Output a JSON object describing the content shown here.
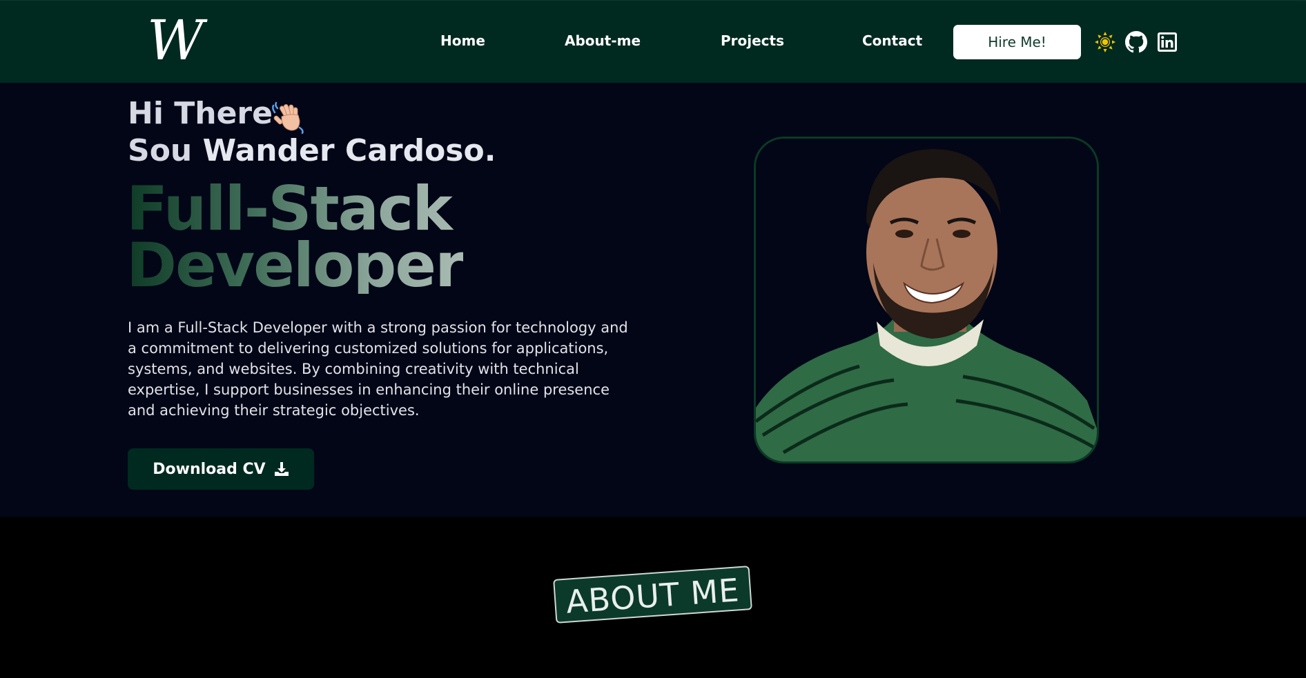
{
  "brand": {
    "logo_text": "W"
  },
  "nav": {
    "links": [
      "Home",
      "About-me",
      "Projects",
      "Contact"
    ],
    "hire_label": "Hire Me!",
    "icons": [
      "sun-icon",
      "github-icon",
      "linkedin-icon"
    ]
  },
  "hero": {
    "greeting": "Hi There",
    "intro_prefix": "Sou ",
    "name": "Wander Cardoso.",
    "role_line1": "Full-Stack",
    "role_line2": "Developer",
    "description": "I am a Full-Stack Developer with a strong passion for technology and a commitment to delivering customized solutions for applications, systems, and websites. By combining creativity with technical expertise, I support businesses in enhancing their online presence and achieving their strategic objectives.",
    "download_label": "Download CV"
  },
  "about": {
    "badge": "ABOUT ME"
  },
  "colors": {
    "nav_bg": "#002a20",
    "hero_bg": "#020617",
    "accent_green": "#0b3a2b",
    "sun_yellow": "#f5c400"
  }
}
